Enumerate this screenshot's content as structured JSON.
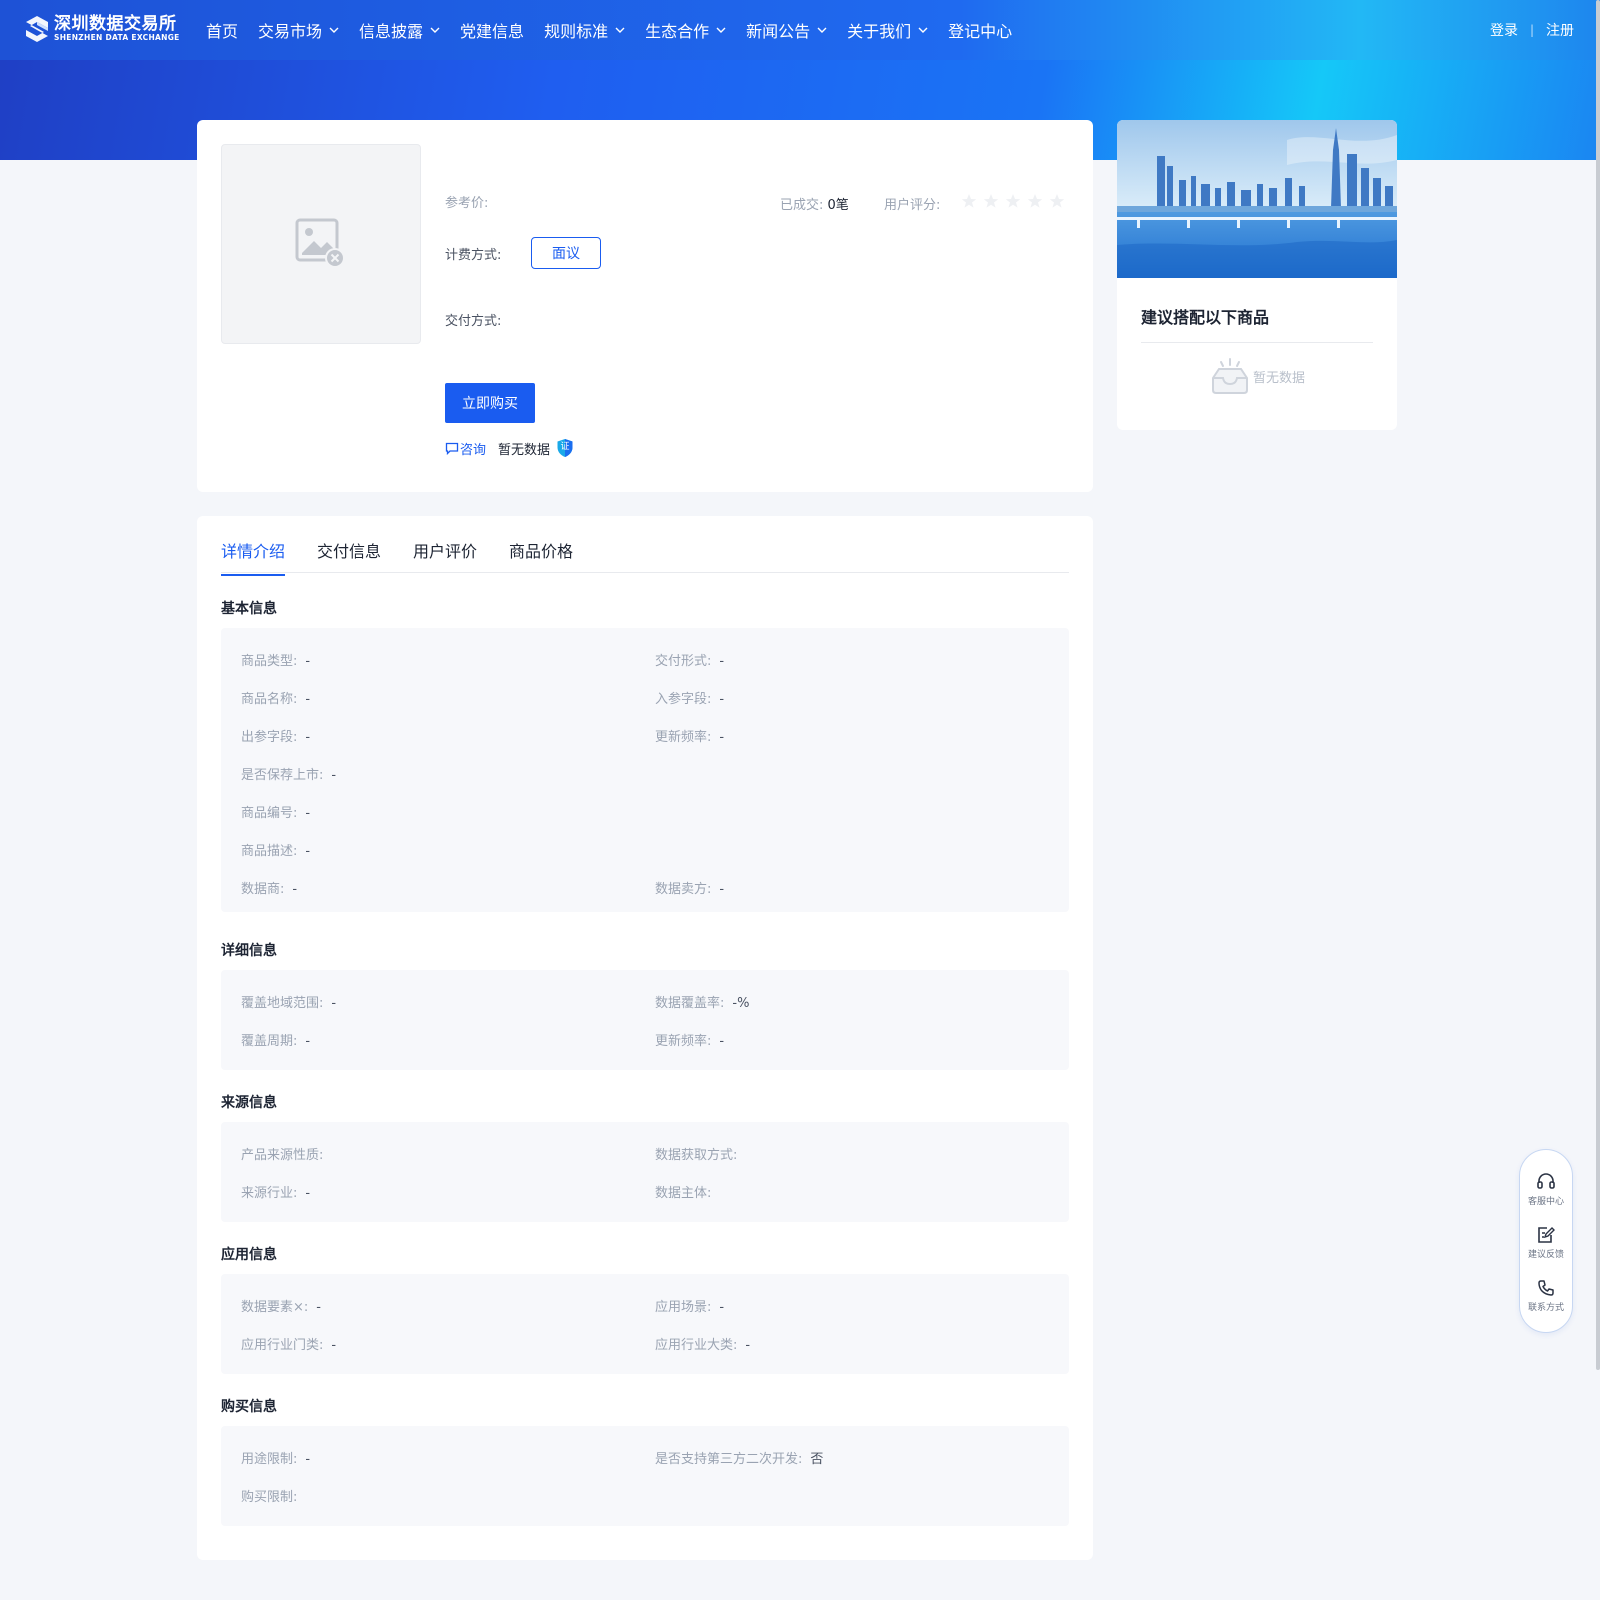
{
  "logo": {
    "cn": "深圳数据交易所",
    "en": "SHENZHEN DATA EXCHANGE"
  },
  "nav": [
    {
      "label": "首页",
      "dropdown": false
    },
    {
      "label": "交易市场",
      "dropdown": true
    },
    {
      "label": "信息披露",
      "dropdown": true
    },
    {
      "label": "党建信息",
      "dropdown": false
    },
    {
      "label": "规则标准",
      "dropdown": true
    },
    {
      "label": "生态合作",
      "dropdown": true
    },
    {
      "label": "新闻公告",
      "dropdown": true
    },
    {
      "label": "关于我们",
      "dropdown": true
    },
    {
      "label": "登记中心",
      "dropdown": false
    }
  ],
  "auth": {
    "login": "登录",
    "sep": "|",
    "register": "注册"
  },
  "product": {
    "ref_price_label": "参考价:",
    "deals_label": "已成交:",
    "deals_value": "0笔",
    "rating_label": "用户评分:",
    "rating_value": 0,
    "rating_max": 5,
    "pricing_label": "计费方式:",
    "pricing_option": "面议",
    "delivery_label": "交付方式:",
    "buy_button": "立即购买",
    "consult": "咨询",
    "cert_text": "暂无数据",
    "cert_badge": "证"
  },
  "sidebar": {
    "title": "建议搭配以下商品",
    "empty": "暂无数据"
  },
  "tabs": [
    {
      "label": "详情介绍",
      "active": true
    },
    {
      "label": "交付信息",
      "active": false
    },
    {
      "label": "用户评价",
      "active": false
    },
    {
      "label": "商品价格",
      "active": false
    }
  ],
  "sections": {
    "basic": {
      "title": "基本信息",
      "rows": [
        {
          "k": "商品类型:",
          "v": "-"
        },
        {
          "k": "交付形式:",
          "v": "-"
        },
        {
          "k": "商品名称:",
          "v": "-"
        },
        {
          "k": "入参字段:",
          "v": "-"
        },
        {
          "k": "出参字段:",
          "v": "-"
        },
        {
          "k": "更新频率:",
          "v": "-"
        },
        {
          "k": "是否保荐上市:",
          "v": "-"
        },
        {
          "k": "商品编号:",
          "v": "-"
        },
        {
          "k": "商品描述:",
          "v": "-"
        },
        {
          "k": "数据商:",
          "v": "-"
        },
        {
          "k": "数据卖方:",
          "v": "-"
        }
      ]
    },
    "detail": {
      "title": "详细信息",
      "rows": [
        {
          "k": "覆盖地域范围:",
          "v": "-"
        },
        {
          "k": "数据覆盖率:",
          "v": "-%"
        },
        {
          "k": "覆盖周期:",
          "v": "-"
        },
        {
          "k": "更新频率:",
          "v": "-"
        }
      ]
    },
    "source": {
      "title": "来源信息",
      "rows": [
        {
          "k": "产品来源性质:",
          "v": ""
        },
        {
          "k": "数据获取方式:",
          "v": ""
        },
        {
          "k": "来源行业:",
          "v": "-"
        },
        {
          "k": "数据主体:",
          "v": ""
        }
      ]
    },
    "application": {
      "title": "应用信息",
      "rows": [
        {
          "k": "数据要素×:",
          "v": "-"
        },
        {
          "k": "应用场景:",
          "v": "-"
        },
        {
          "k": "应用行业门类:",
          "v": "-"
        },
        {
          "k": "应用行业大类:",
          "v": "-"
        }
      ]
    },
    "purchase": {
      "title": "购买信息",
      "rows": [
        {
          "k": "用途限制:",
          "v": "-"
        },
        {
          "k": "是否支持第三方二次开发:",
          "v": "否"
        },
        {
          "k": "购买限制:",
          "v": ""
        }
      ]
    }
  },
  "float_tools": [
    {
      "label": "客服中心",
      "icon": "headset-icon"
    },
    {
      "label": "建议反馈",
      "icon": "feedback-edit-icon"
    },
    {
      "label": "联系方式",
      "icon": "phone-icon"
    }
  ],
  "colors": {
    "primary": "#1a5cf0",
    "nav_start": "#1e52d6",
    "nav_end": "#22b8f5"
  }
}
